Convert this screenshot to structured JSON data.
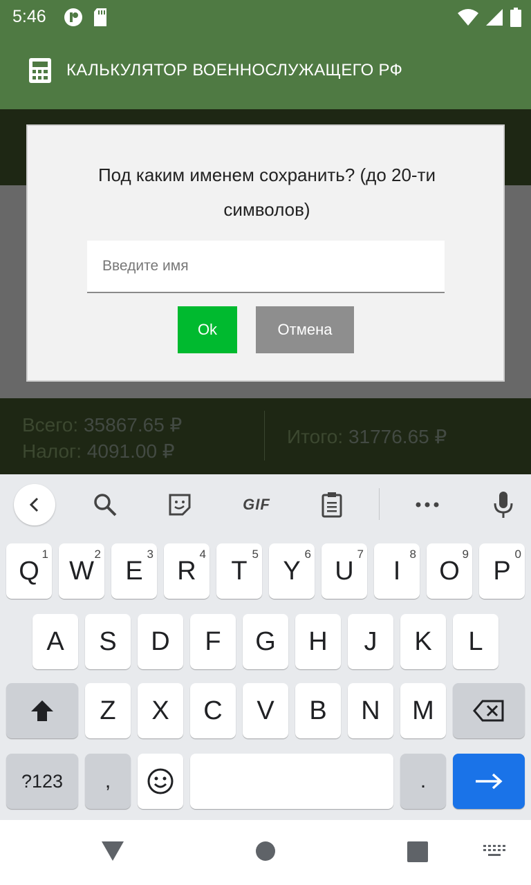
{
  "status_bar": {
    "time": "5:46",
    "icons": [
      "p-app-icon",
      "sd-card-icon",
      "wifi-icon",
      "signal-icon",
      "battery-icon"
    ]
  },
  "app_bar": {
    "icon": "calculator-icon",
    "title": "КАЛЬКУЛЯТОР ВОЕННОСЛУЖАЩЕГО РФ",
    "color": "#4f7a43"
  },
  "summary": {
    "total_label": "Всего:",
    "total_value": "35867.65 ₽",
    "tax_label": "Налог:",
    "tax_value": "4091.00 ₽",
    "result_label": "Итого:",
    "result_value": "31776.65 ₽"
  },
  "dialog": {
    "title": "Под каким именем сохранить? (до 20-ти символов)",
    "input_placeholder": "Введите имя",
    "input_value": "",
    "ok_label": "Ok",
    "cancel_label": "Отмена",
    "ok_color": "#00ba2f",
    "cancel_color": "#8e8e8e"
  },
  "keyboard": {
    "toolbar": [
      "back-icon",
      "search-icon",
      "sticker-icon",
      "GIF",
      "clipboard-icon",
      "more-icon",
      "microphone-icon"
    ],
    "row1": [
      {
        "label": "Q",
        "hint": "1"
      },
      {
        "label": "W",
        "hint": "2"
      },
      {
        "label": "E",
        "hint": "3"
      },
      {
        "label": "R",
        "hint": "4"
      },
      {
        "label": "T",
        "hint": "5"
      },
      {
        "label": "Y",
        "hint": "6"
      },
      {
        "label": "U",
        "hint": "7"
      },
      {
        "label": "I",
        "hint": "8"
      },
      {
        "label": "O",
        "hint": "9"
      },
      {
        "label": "P",
        "hint": "0"
      }
    ],
    "row2": [
      "A",
      "S",
      "D",
      "F",
      "G",
      "H",
      "J",
      "K",
      "L"
    ],
    "row3": [
      "Z",
      "X",
      "C",
      "V",
      "B",
      "N",
      "M"
    ],
    "symbols_label": "?123",
    "comma_label": ",",
    "period_label": ".",
    "enter_color": "#1a73e8"
  },
  "nav_bar": {
    "icons": [
      "back-triangle-icon",
      "home-circle-icon",
      "recents-square-icon",
      "keyboard-switch-icon"
    ]
  }
}
